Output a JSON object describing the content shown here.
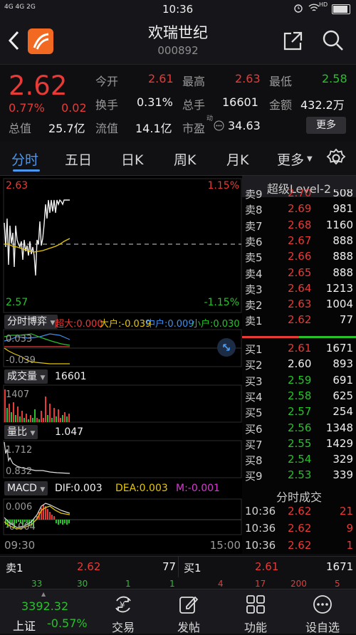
{
  "status_bar": {
    "left": "4G 4G 2G",
    "time": "10:36",
    "right": "HD"
  },
  "header": {
    "title": "欢瑞世纪",
    "code": "000892"
  },
  "quote": {
    "price": "2.62",
    "change_pct": "0.77%",
    "change": "0.02",
    "open_label": "今开",
    "open": "2.61",
    "high_label": "最高",
    "high": "2.63",
    "low_label": "最低",
    "low": "2.58",
    "turnover_label": "换手",
    "turnover": "0.31%",
    "volume_label": "总手",
    "volume": "16601",
    "amount_label": "金额",
    "amount": "432.2万",
    "mktcap_label": "总值",
    "mktcap": "25.7亿",
    "float_label": "流值",
    "float": "14.1亿",
    "pe_label": "市盈",
    "pe_sup": "动",
    "pe": "34.63",
    "more": "更多"
  },
  "tabs": [
    "分时",
    "五日",
    "日K",
    "周K",
    "月K",
    "更多"
  ],
  "chart": {
    "price_top": "2.63",
    "pct_top": "1.15%",
    "price_bottom": "2.57",
    "pct_bottom": "-1.15%",
    "game_label": "分时博弈",
    "game_items": {
      "super": "超大:0.000",
      "big": "大户:-0.039",
      "mid": "中户:0.009",
      "small": "小户:0.030"
    },
    "game_top": "0.033",
    "game_bottom": "-0.039",
    "vol_label": "成交量",
    "vol_value": "16601",
    "vol_top": "1407",
    "ratio_label": "量比",
    "ratio_value": "1.047",
    "ratio_top": "1.712",
    "ratio_bottom": "0.832",
    "macd_label": "MACD",
    "dif": "DIF:0.003",
    "dea": "DEA:0.003",
    "m": "M:-0.001",
    "macd_top": "0.006",
    "macd_bottom": "-0.004",
    "time_start": "09:30",
    "time_end": "15:00"
  },
  "book": {
    "title": "超级Level-2",
    "sells": [
      {
        "label": "卖9",
        "price": "2.70",
        "vol": "508"
      },
      {
        "label": "卖8",
        "price": "2.69",
        "vol": "981"
      },
      {
        "label": "卖7",
        "price": "2.68",
        "vol": "1160"
      },
      {
        "label": "卖6",
        "price": "2.67",
        "vol": "888"
      },
      {
        "label": "卖5",
        "price": "2.66",
        "vol": "888"
      },
      {
        "label": "卖4",
        "price": "2.65",
        "vol": "888"
      },
      {
        "label": "卖3",
        "price": "2.64",
        "vol": "1213"
      },
      {
        "label": "卖2",
        "price": "2.63",
        "vol": "1004"
      },
      {
        "label": "卖1",
        "price": "2.62",
        "vol": "77"
      }
    ],
    "buys": [
      {
        "label": "买1",
        "price": "2.61",
        "vol": "1671"
      },
      {
        "label": "买2",
        "price": "2.60",
        "vol": "893"
      },
      {
        "label": "买3",
        "price": "2.59",
        "vol": "691"
      },
      {
        "label": "买4",
        "price": "2.58",
        "vol": "625"
      },
      {
        "label": "买5",
        "price": "2.57",
        "vol": "254"
      },
      {
        "label": "买6",
        "price": "2.56",
        "vol": "1348"
      },
      {
        "label": "买7",
        "price": "2.55",
        "vol": "1429"
      },
      {
        "label": "买8",
        "price": "2.54",
        "vol": "329"
      },
      {
        "label": "买9",
        "price": "2.53",
        "vol": "339"
      }
    ],
    "trades_title": "分时成交",
    "trades": [
      {
        "time": "10:36",
        "price": "2.62",
        "vol": "21"
      },
      {
        "time": "10:36",
        "price": "2.62",
        "vol": "9"
      },
      {
        "time": "10:36",
        "price": "2.62",
        "vol": "1"
      }
    ]
  },
  "bottom": {
    "sell1_label": "卖1",
    "sell1_price": "2.62",
    "sell1_vol": "77",
    "buy1_label": "买1",
    "buy1_price": "2.61",
    "buy1_vol": "1671",
    "row2": [
      "33",
      "30",
      "1",
      "1",
      "4",
      "17",
      "200",
      "5"
    ]
  },
  "index": {
    "value": "3392.32",
    "name": "上证",
    "change": "-0.57%"
  },
  "nav": [
    "交易",
    "发帖",
    "功能",
    "设自选"
  ]
}
